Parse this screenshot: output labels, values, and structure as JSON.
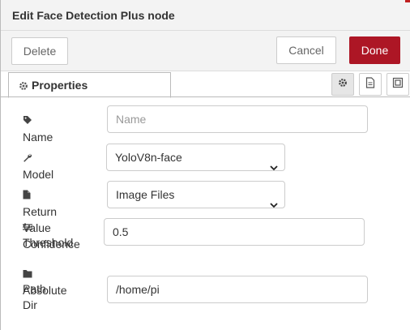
{
  "header": {
    "title": "Edit Face Detection Plus node"
  },
  "toolbar": {
    "delete_label": "Delete",
    "cancel_label": "Cancel",
    "done_label": "Done"
  },
  "tabs": [
    {
      "label": "Properties",
      "icon": "gear-icon"
    }
  ],
  "tab_actions": [
    {
      "icon": "gear-icon"
    },
    {
      "icon": "file-icon"
    },
    {
      "icon": "frame-icon"
    }
  ],
  "form": {
    "name": {
      "label": "Name",
      "icon": "tag-icon",
      "value": "",
      "placeholder": "Name"
    },
    "model": {
      "label": "Model",
      "icon": "wrench-icon",
      "value": "YoloV8n-face"
    },
    "return_value": {
      "label": "Return Value",
      "icon": "file-icon",
      "value": "Image Files"
    },
    "confidence": {
      "label_line1": "Confidence",
      "label_line2": "Threshold",
      "icon": "sliders-icon",
      "value": "0.5"
    },
    "path": {
      "label_line1": "Absolute",
      "label_line2": "Path Dir",
      "icon": "folder-icon",
      "value": "/home/pi"
    }
  },
  "colors": {
    "done": "#ad1625",
    "accent": "#c02020"
  }
}
